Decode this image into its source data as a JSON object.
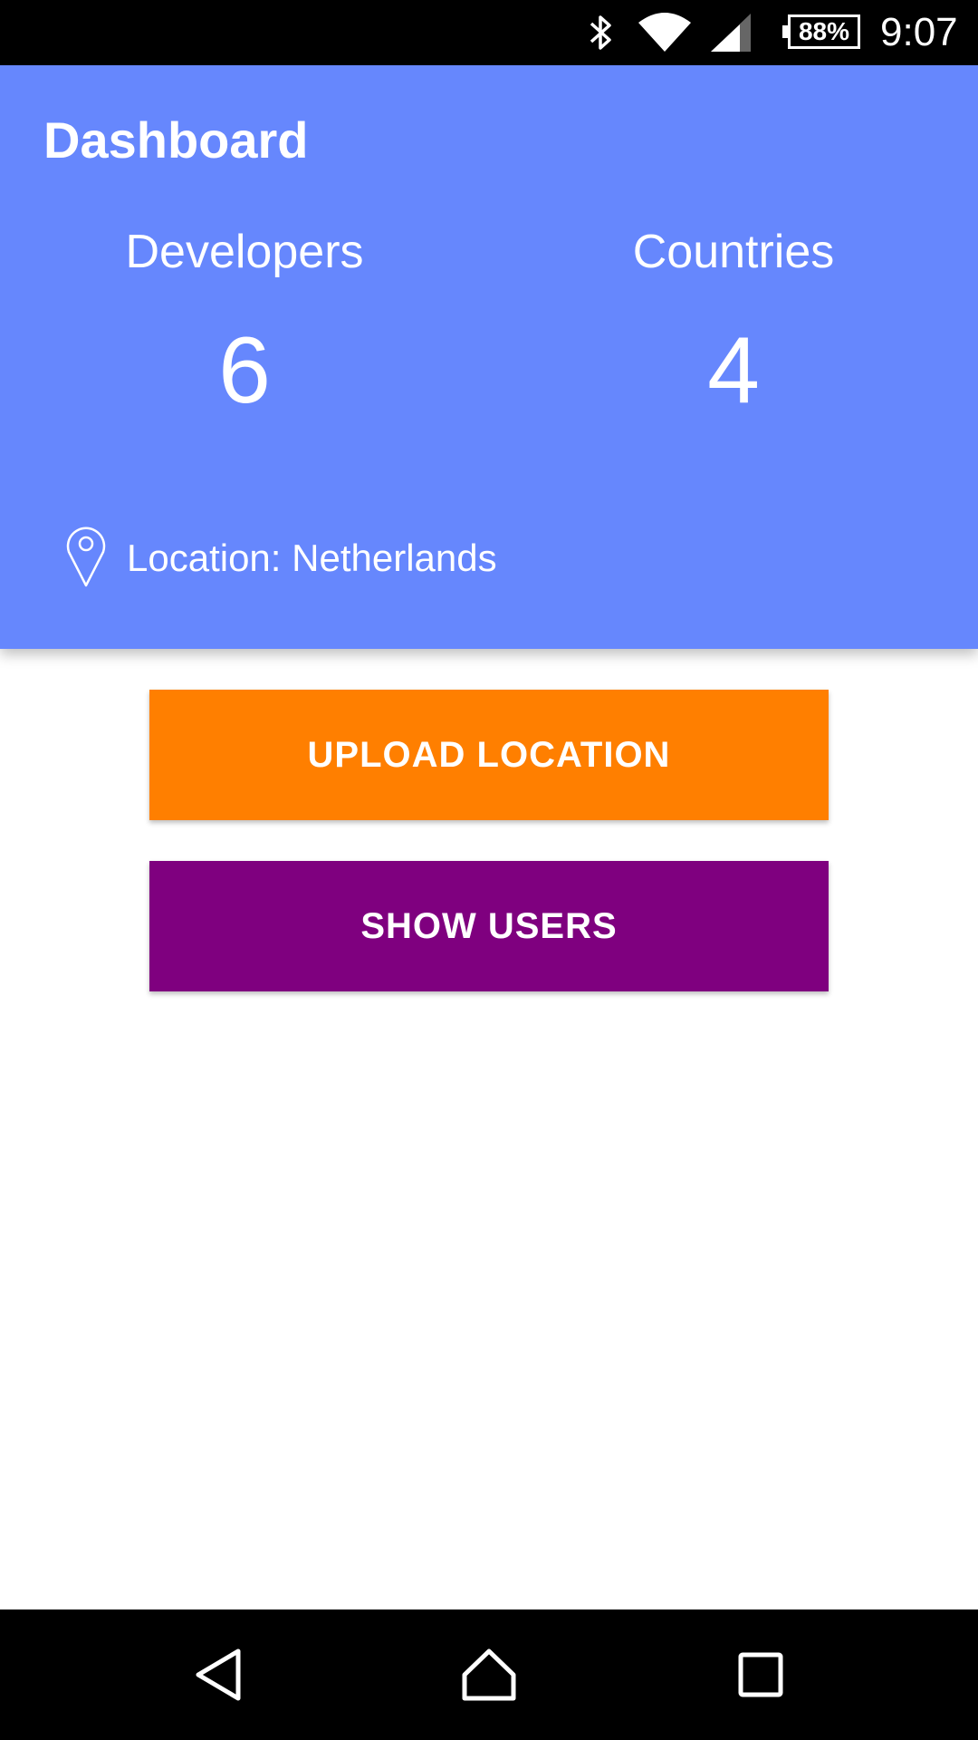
{
  "status_bar": {
    "battery_percent": "88%",
    "time": "9:07",
    "icons": [
      "bluetooth-icon",
      "wifi-icon",
      "cell-signal-icon",
      "battery-icon"
    ]
  },
  "header": {
    "title": "Dashboard",
    "background_color": "#6687fd"
  },
  "stats": {
    "developers": {
      "label": "Developers",
      "value": "6"
    },
    "countries": {
      "label": "Countries",
      "value": "4"
    }
  },
  "location": {
    "icon": "location-pin-icon",
    "text": "Location: Netherlands"
  },
  "actions": {
    "upload_location": {
      "label": "UPLOAD LOCATION",
      "color": "#ff7f00"
    },
    "show_users": {
      "label": "SHOW USERS",
      "color": "#7f007f"
    }
  },
  "nav_bar": {
    "buttons": [
      "back-icon",
      "home-icon",
      "recents-icon"
    ]
  }
}
